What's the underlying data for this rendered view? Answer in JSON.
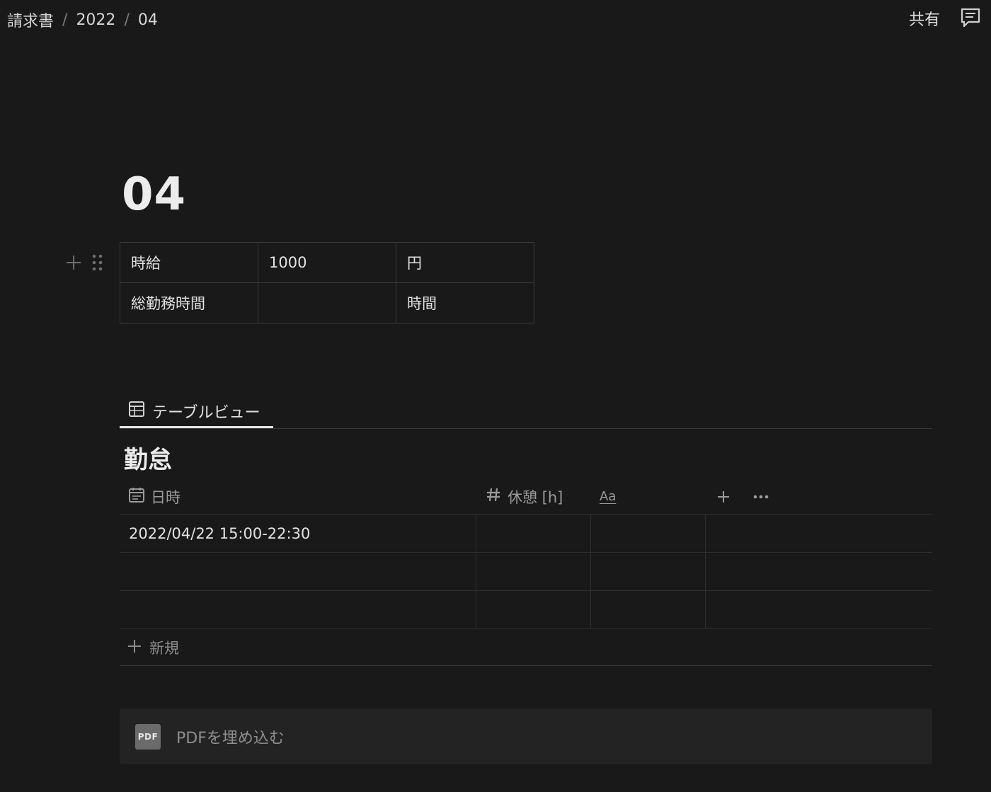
{
  "breadcrumb": {
    "items": [
      "請求書",
      "2022",
      "04"
    ],
    "separator": "/"
  },
  "topbar": {
    "share_label": "共有",
    "comment_icon": "comment-icon"
  },
  "page": {
    "title": "04"
  },
  "rate_table": {
    "rows": [
      [
        "時給",
        "1000",
        "円"
      ],
      [
        "総勤務時間",
        "",
        "時間"
      ]
    ]
  },
  "view": {
    "tab_label": "テーブルビュー",
    "tab_icon": "table-icon"
  },
  "database": {
    "title": "勤怠",
    "columns": [
      {
        "icon": "calendar-icon",
        "label": "日時"
      },
      {
        "icon": "number-icon",
        "label": "休憩 [h]"
      },
      {
        "icon": "text-icon",
        "label": "Aa"
      }
    ],
    "add_column_icon": "plus-icon",
    "more_icon": "more-icon",
    "rows": [
      {
        "datetime": "2022/04/22 15:00-22:30",
        "break": "",
        "text": ""
      },
      {
        "datetime": "",
        "break": "",
        "text": ""
      },
      {
        "datetime": "",
        "break": "",
        "text": ""
      }
    ],
    "new_label": "新規"
  },
  "pdf_embed": {
    "icon_text": "PDF",
    "label": "PDFを埋め込む"
  }
}
